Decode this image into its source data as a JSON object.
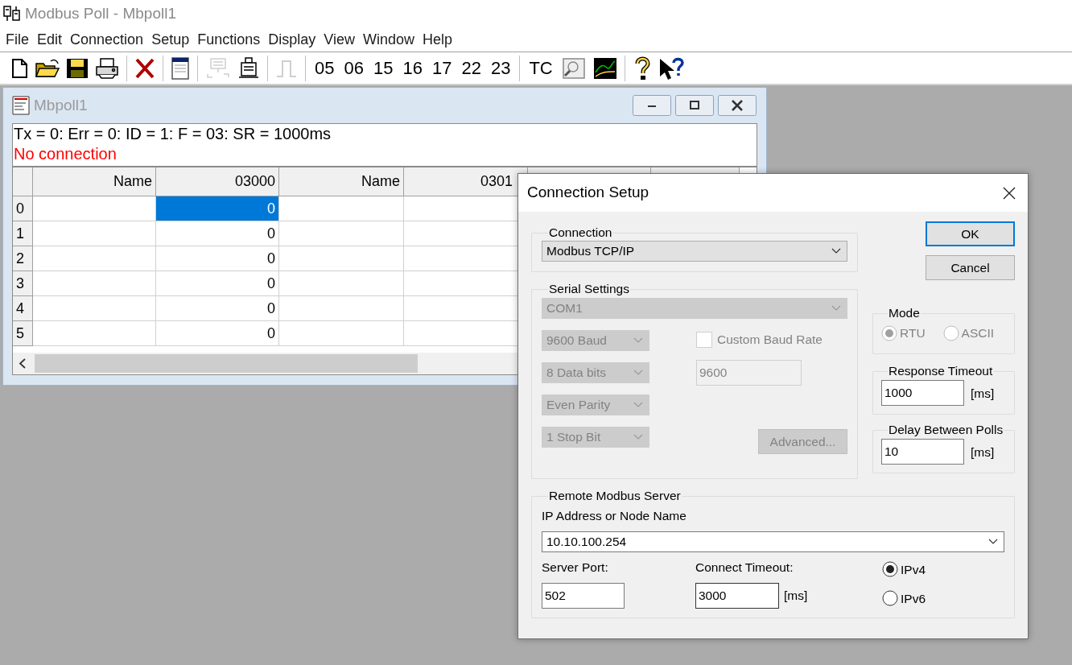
{
  "app": {
    "title": "Modbus Poll - Mbpoll1"
  },
  "menu": [
    "File",
    "Edit",
    "Connection",
    "Setup",
    "Functions",
    "Display",
    "View",
    "Window",
    "Help"
  ],
  "toolbar": [
    {
      "kind": "icon",
      "disabled": false
    },
    {
      "kind": "icon",
      "disabled": false
    },
    {
      "kind": "icon",
      "disabled": false
    },
    {
      "kind": "icon",
      "disabled": false
    },
    {
      "kind": "separator"
    },
    {
      "kind": "icon",
      "disabled": false
    },
    {
      "kind": "separator"
    },
    {
      "kind": "icon",
      "disabled": false
    },
    {
      "kind": "separator"
    },
    {
      "kind": "icon",
      "disabled": true
    },
    {
      "kind": "icon",
      "disabled": false
    },
    {
      "kind": "separator"
    },
    {
      "kind": "icon",
      "disabled": true
    },
    {
      "kind": "separator"
    },
    {
      "kind": "text",
      "label": "05"
    },
    {
      "kind": "text",
      "label": "06"
    },
    {
      "kind": "text",
      "label": "15"
    },
    {
      "kind": "text",
      "label": "16"
    },
    {
      "kind": "text",
      "label": "17"
    },
    {
      "kind": "text",
      "label": "22"
    },
    {
      "kind": "text",
      "label": "23"
    },
    {
      "kind": "separator"
    },
    {
      "kind": "text",
      "label": "TC"
    },
    {
      "kind": "icon",
      "disabled": false
    },
    {
      "kind": "icon",
      "disabled": false
    },
    {
      "kind": "separator"
    },
    {
      "kind": "icon",
      "disabled": false
    },
    {
      "kind": "icon",
      "disabled": false
    }
  ],
  "child_window": {
    "title": "Mbpoll1",
    "status": [
      {
        "text": "Tx = 0: Err = 0: ID = 1: F = 03: SR = 1000ms",
        "kind": "info"
      },
      {
        "text": "No connection",
        "kind": "error"
      }
    ],
    "columns": [
      "Name",
      "03000",
      "Name",
      "0301"
    ],
    "rows": [
      {
        "header": "0",
        "value": "0",
        "selected": true
      },
      {
        "header": "1",
        "value": "0",
        "selected": false
      },
      {
        "header": "2",
        "value": "0",
        "selected": false
      },
      {
        "header": "3",
        "value": "0",
        "selected": false
      },
      {
        "header": "4",
        "value": "0",
        "selected": false
      },
      {
        "header": "5",
        "value": "0",
        "selected": false
      }
    ]
  },
  "dialog": {
    "title": "Connection Setup",
    "connection": {
      "label": "Connection",
      "value": "Modbus TCP/IP"
    },
    "serial": {
      "label": "Serial Settings",
      "disabled": true,
      "port": "COM1",
      "baud": "9600 Baud",
      "data_bits": "8 Data bits",
      "parity": "Even Parity",
      "stop_bits": "1 Stop Bit",
      "custom_baud": {
        "label": "Custom Baud Rate",
        "checked": false
      },
      "custom_value": "9600",
      "advanced": "Advanced..."
    },
    "buttons": [
      {
        "label": "OK",
        "default": true
      },
      {
        "label": "Cancel",
        "default": false
      }
    ],
    "mode": {
      "label": "Mode",
      "disabled": true,
      "options": [
        {
          "label": "RTU",
          "selected": true
        },
        {
          "label": "ASCII",
          "selected": false
        }
      ]
    },
    "response_timeout": {
      "label": "Response Timeout",
      "value": "1000",
      "unit": "[ms]"
    },
    "delay_between_polls": {
      "label": "Delay Between Polls",
      "value": "10",
      "unit": "[ms]"
    },
    "remote": {
      "label": "Remote Modbus Server",
      "ip_label": "IP Address or Node Name",
      "ip_value": "10.10.100.254",
      "port_label": "Server Port:",
      "port_value": "502",
      "timeout_label": "Connect Timeout:",
      "timeout_value": "3000",
      "timeout_unit": "[ms]",
      "ip_versions": [
        {
          "label": "IPv4",
          "selected": true
        },
        {
          "label": "IPv6",
          "selected": false
        }
      ]
    }
  }
}
